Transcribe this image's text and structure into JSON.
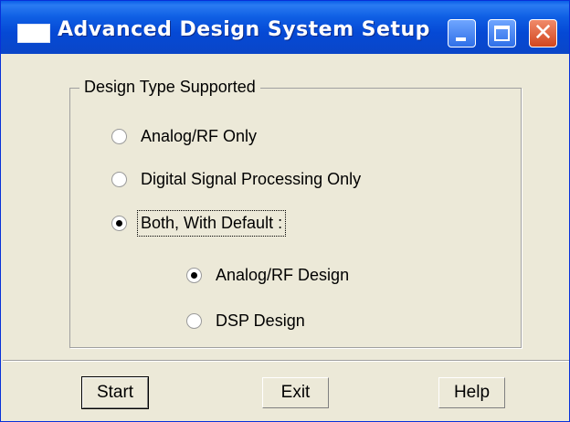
{
  "window": {
    "title": "Advanced Design System Setup",
    "close_glyph": "✕"
  },
  "group": {
    "legend": "Design Type Supported",
    "options": [
      {
        "label": "Analog/RF Only",
        "selected": false
      },
      {
        "label": "Digital Signal Processing Only",
        "selected": false
      },
      {
        "label": "Both, With Default :",
        "selected": true
      }
    ],
    "default_options": [
      {
        "label": "Analog/RF Design",
        "selected": true
      },
      {
        "label": "DSP Design",
        "selected": false
      }
    ]
  },
  "buttons": {
    "start": "Start",
    "exit": "Exit",
    "help": "Help"
  },
  "colors": {
    "titlebar": "#0549d5",
    "dialog_bg": "#ece9d8",
    "close_button": "#d2461f"
  },
  "icons": [
    "window-icon",
    "minimize-icon",
    "maximize-icon",
    "close-icon"
  ]
}
